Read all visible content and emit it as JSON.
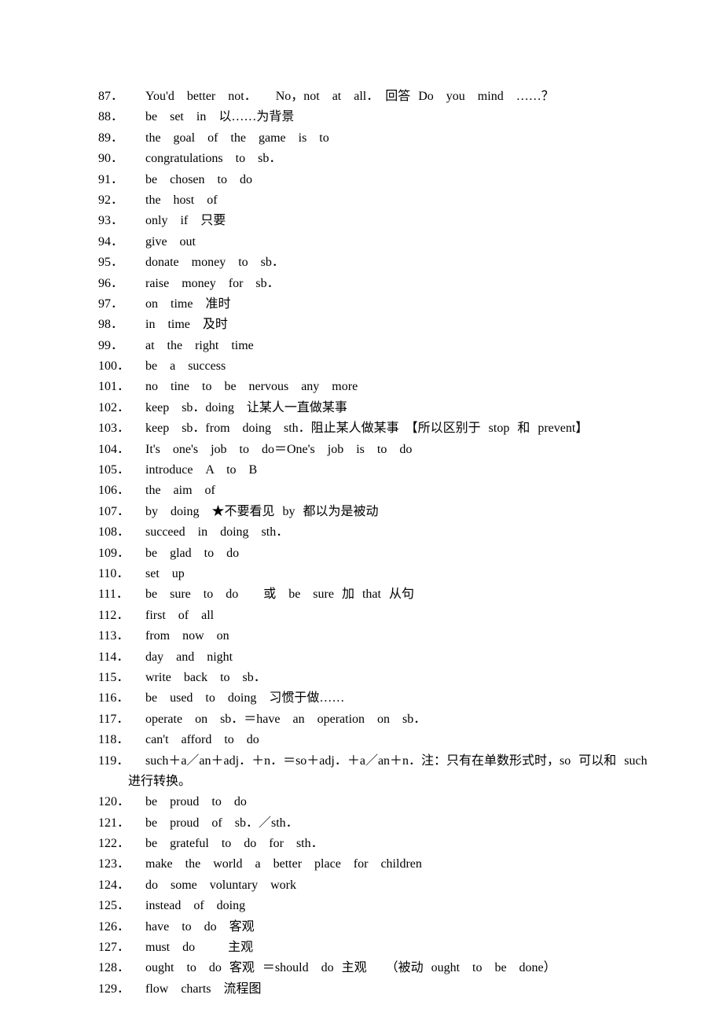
{
  "items": [
    {
      "num": "87．",
      "text": "You'd　better　not．　　No，not　at　all．　回答 Do　you　mind　……？"
    },
    {
      "num": "88．",
      "text": "be　set　in　以……为背景"
    },
    {
      "num": "89．",
      "text": "the　goal　of　the　game　is　to"
    },
    {
      "num": "90．",
      "text": "congratulations　to　sb．"
    },
    {
      "num": "91．",
      "text": "be　chosen　to　do"
    },
    {
      "num": "92．",
      "text": "the　host　of"
    },
    {
      "num": "93．",
      "text": "only　if　只要"
    },
    {
      "num": "94．",
      "text": "give　out"
    },
    {
      "num": "95．",
      "text": "donate　money　to　sb．"
    },
    {
      "num": "96．",
      "text": "raise　money　for　sb．"
    },
    {
      "num": "97．",
      "text": "on　time　准时"
    },
    {
      "num": "98．",
      "text": "in　time　及时"
    },
    {
      "num": "99．",
      "text": "at　the　right　time"
    },
    {
      "num": "100．",
      "text": "be　a　success"
    },
    {
      "num": "101．",
      "text": "no　tine　to　be　nervous　any　more"
    },
    {
      "num": "102．",
      "text": "keep　sb．doing　让某人一直做某事"
    },
    {
      "num": "103．",
      "text": "keep　sb．from　doing　sth．阻止某人做某事　【所以区别于 stop 和 prevent】"
    },
    {
      "num": "104．",
      "text": "It's　one's　job　to　do＝One's　job　is　to　do"
    },
    {
      "num": "105．",
      "text": "introduce　A　to　B"
    },
    {
      "num": "106．",
      "text": "the　aim　of"
    },
    {
      "num": "107．",
      "text": "by　doing　★不要看见 by 都以为是被动"
    },
    {
      "num": "108．",
      "text": "succeed　in　doing　sth．"
    },
    {
      "num": "109．",
      "text": "be　glad　to　do"
    },
    {
      "num": "110．",
      "text": "set　up"
    },
    {
      "num": "111．",
      "text": "be　sure　to　do　　或　be　sure 加 that 从句"
    },
    {
      "num": "112．",
      "text": "first　of　all"
    },
    {
      "num": "113．",
      "text": "from　now　on"
    },
    {
      "num": "114．",
      "text": "day　and　night"
    },
    {
      "num": "115．",
      "text": "write　back　to　sb．"
    },
    {
      "num": "116．",
      "text": "be　used　to　doing　习惯于做……"
    },
    {
      "num": "117．",
      "text": "operate　on　sb．＝have　an　operation　on　sb．"
    },
    {
      "num": "118．",
      "text": "can't　afford　to　do"
    },
    {
      "num": "119．",
      "text": "such＋a／an＋adj．＋n．＝so＋adj．＋a／an＋n．注：只有在单数形式时，so 可以和 such",
      "wrap": "进行转换。"
    },
    {
      "num": "120．",
      "text": "be　proud　to　do"
    },
    {
      "num": "121．",
      "text": "be　proud　of　sb．／sth．"
    },
    {
      "num": "122．",
      "text": "be　grateful　to　do　for　sth．"
    },
    {
      "num": "123．",
      "text": "make　the　world　a　better　place　for　children"
    },
    {
      "num": "124．",
      "text": "do　some　voluntary　work"
    },
    {
      "num": "125．",
      "text": "instead　of　doing"
    },
    {
      "num": "126．",
      "text": "have　to　do　客观"
    },
    {
      "num": "127．",
      "text": "must　do　　 主观"
    },
    {
      "num": "128．",
      "text": "ought　to　do 客观 ＝should　do 主观　　（被动 ought　to　be　done）"
    },
    {
      "num": "129．",
      "text": "flow　charts　流程图"
    }
  ]
}
